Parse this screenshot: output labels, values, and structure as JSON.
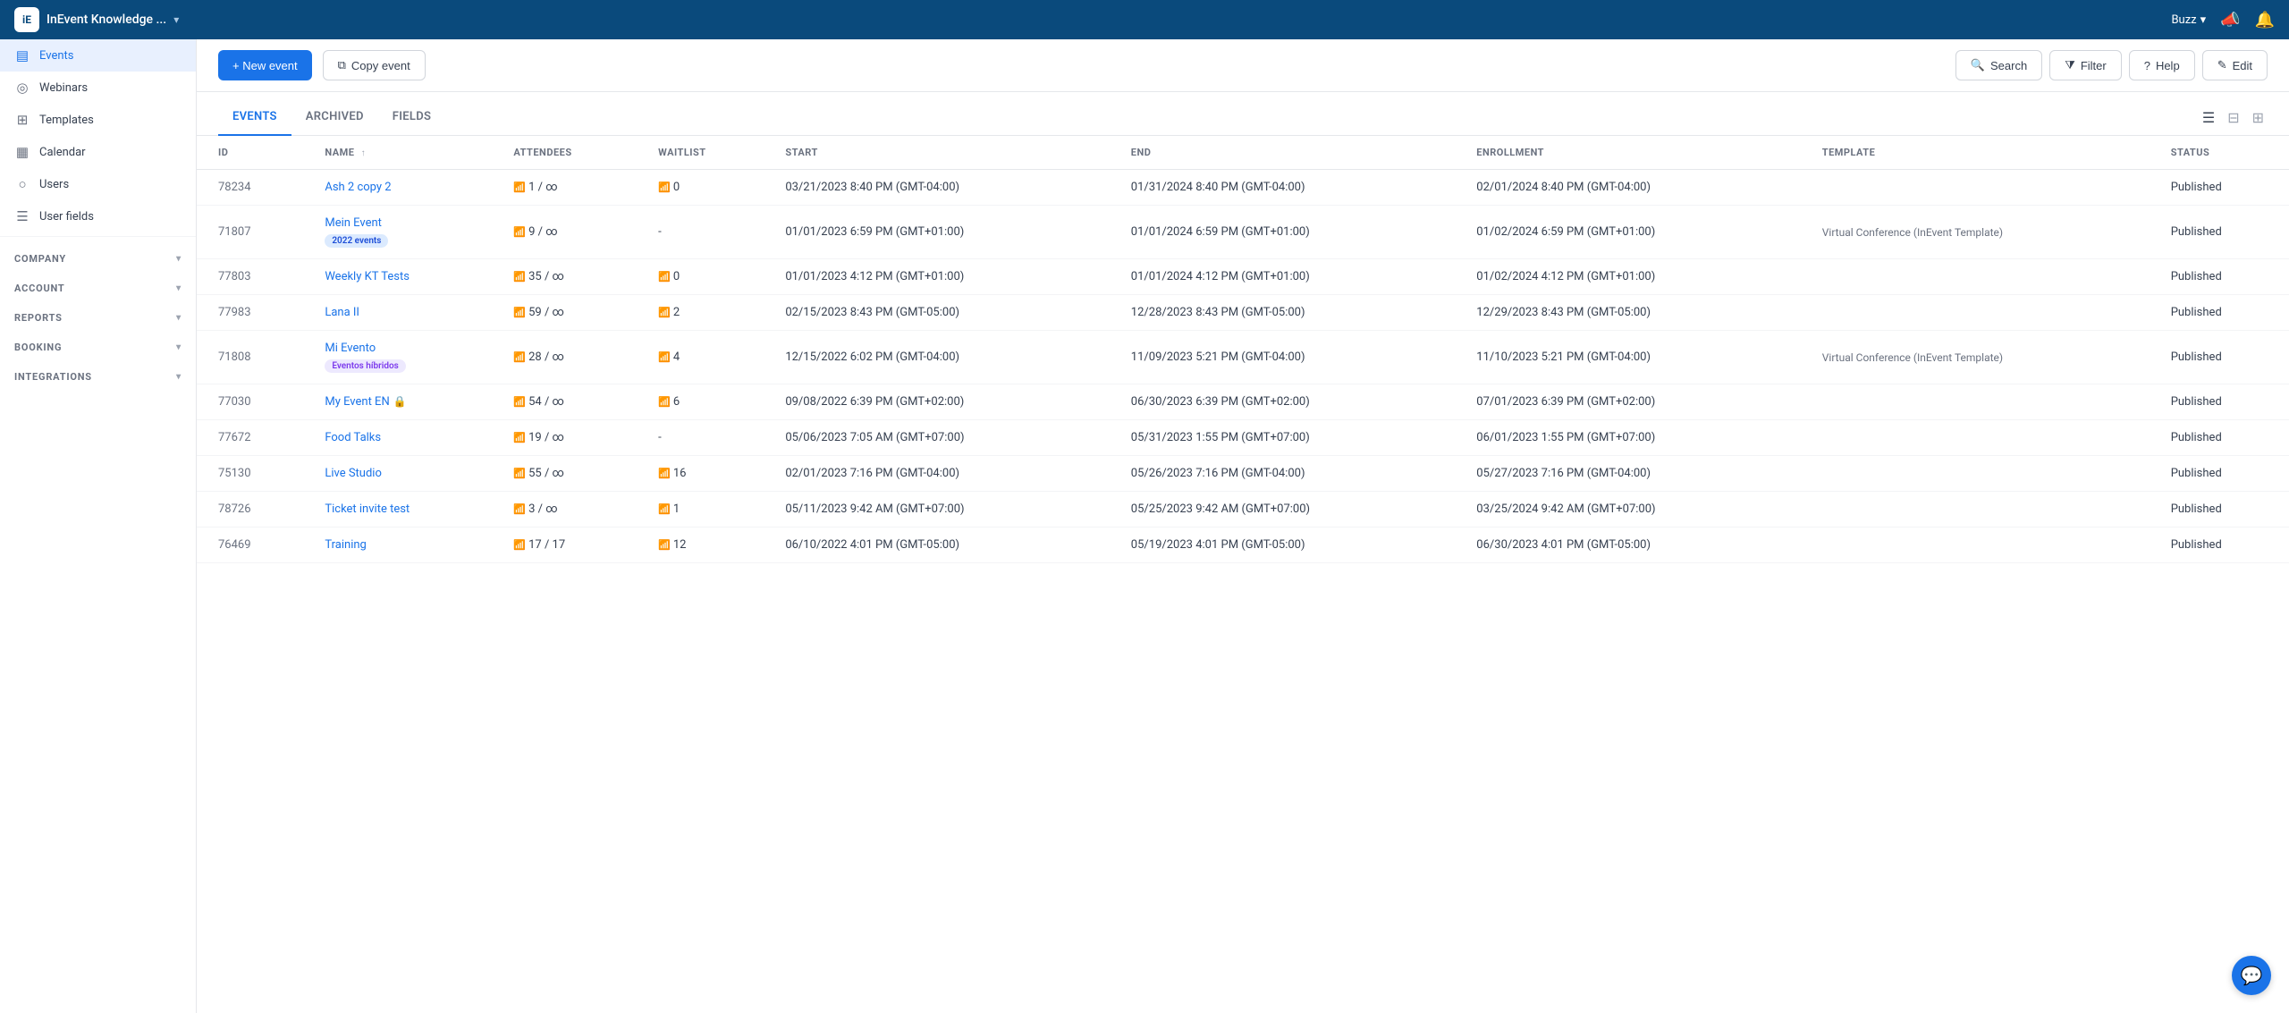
{
  "app": {
    "title": "InEvent Knowledge ...",
    "chevron": "▾"
  },
  "topnav": {
    "buzz_label": "Buzz",
    "chevron": "▾"
  },
  "sidebar": {
    "events_label": "EVENTS",
    "items": [
      {
        "id": "events",
        "label": "Events",
        "icon": "▤",
        "active": true
      },
      {
        "id": "webinars",
        "label": "Webinars",
        "icon": "🎙",
        "active": false
      },
      {
        "id": "templates",
        "label": "Templates",
        "icon": "◎",
        "active": false
      },
      {
        "id": "calendar",
        "label": "Calendar",
        "icon": "📅",
        "active": false
      },
      {
        "id": "users",
        "label": "Users",
        "icon": "👤",
        "active": false
      },
      {
        "id": "user-fields",
        "label": "User fields",
        "icon": "☰",
        "active": false
      }
    ],
    "sections": [
      {
        "id": "company",
        "label": "COMPANY",
        "chevron": "▾"
      },
      {
        "id": "account",
        "label": "ACCOUNT",
        "chevron": "▾"
      },
      {
        "id": "reports",
        "label": "REPORTS",
        "chevron": "▾"
      },
      {
        "id": "booking",
        "label": "BOOKING",
        "chevron": "▾"
      },
      {
        "id": "integrations",
        "label": "INTEGRATIONS",
        "chevron": "▾"
      }
    ]
  },
  "toolbar": {
    "new_event_label": "+ New event",
    "copy_event_label": "Copy event",
    "search_label": "Search",
    "filter_label": "Filter",
    "help_label": "Help",
    "edit_label": "Edit"
  },
  "tabs": {
    "items": [
      {
        "id": "events",
        "label": "EVENTS",
        "active": true
      },
      {
        "id": "archived",
        "label": "ARCHIVED",
        "active": false
      },
      {
        "id": "fields",
        "label": "FIELDS",
        "active": false
      }
    ]
  },
  "table": {
    "columns": [
      {
        "id": "id",
        "label": "ID"
      },
      {
        "id": "name",
        "label": "Name",
        "sort": "↑"
      },
      {
        "id": "attendees",
        "label": "Attendees"
      },
      {
        "id": "waitlist",
        "label": "Waitlist"
      },
      {
        "id": "start",
        "label": "Start"
      },
      {
        "id": "end",
        "label": "End"
      },
      {
        "id": "enrollment",
        "label": "Enrollment"
      },
      {
        "id": "template",
        "label": "Template"
      },
      {
        "id": "status",
        "label": "Status"
      }
    ],
    "rows": [
      {
        "id": "78234",
        "name": "Ash 2 copy 2",
        "name_link": true,
        "tags": [],
        "attendees": "1 / ∞",
        "waitlist": "0",
        "start": "03/21/2023 8:40 PM (GMT-04:00)",
        "end": "01/31/2024 8:40 PM (GMT-04:00)",
        "enrollment": "02/01/2024 8:40 PM (GMT-04:00)",
        "template": "",
        "status": "Published",
        "lock": false
      },
      {
        "id": "71807",
        "name": "Mein Event",
        "name_link": true,
        "tags": [
          "2022 events"
        ],
        "tag_color": "blue",
        "attendees": "9 / ∞",
        "waitlist": "-",
        "start": "01/01/2023 6:59 PM (GMT+01:00)",
        "end": "01/01/2024 6:59 PM (GMT+01:00)",
        "enrollment": "01/02/2024 6:59 PM (GMT+01:00)",
        "template": "Virtual Conference (InEvent Template)",
        "status": "Published",
        "lock": false
      },
      {
        "id": "77803",
        "name": "Weekly KT Tests",
        "name_link": true,
        "tags": [],
        "attendees": "35 / ∞",
        "waitlist": "0",
        "start": "01/01/2023 4:12 PM (GMT+01:00)",
        "end": "01/01/2024 4:12 PM (GMT+01:00)",
        "enrollment": "01/02/2024 4:12 PM (GMT+01:00)",
        "template": "",
        "status": "Published",
        "lock": false
      },
      {
        "id": "77983",
        "name": "Lana II",
        "name_link": true,
        "tags": [],
        "attendees": "59 / ∞",
        "waitlist": "2",
        "start": "02/15/2023 8:43 PM (GMT-05:00)",
        "end": "12/28/2023 8:43 PM (GMT-05:00)",
        "enrollment": "12/29/2023 8:43 PM (GMT-05:00)",
        "template": "",
        "status": "Published",
        "lock": false
      },
      {
        "id": "71808",
        "name": "Mi Evento",
        "name_link": true,
        "tags": [
          "Eventos híbridos"
        ],
        "tag_color": "purple",
        "attendees": "28 / ∞",
        "waitlist": "4",
        "start": "12/15/2022 6:02 PM (GMT-04:00)",
        "end": "11/09/2023 5:21 PM (GMT-04:00)",
        "enrollment": "11/10/2023 5:21 PM (GMT-04:00)",
        "template": "Virtual Conference (InEvent Template)",
        "status": "Published",
        "lock": false
      },
      {
        "id": "77030",
        "name": "My Event EN",
        "name_link": true,
        "tags": [],
        "attendees": "54 / ∞",
        "waitlist": "6",
        "start": "09/08/2022 6:39 PM (GMT+02:00)",
        "end": "06/30/2023 6:39 PM (GMT+02:00)",
        "enrollment": "07/01/2023 6:39 PM (GMT+02:00)",
        "template": "",
        "status": "Published",
        "lock": true
      },
      {
        "id": "77672",
        "name": "Food Talks",
        "name_link": true,
        "tags": [],
        "attendees": "19 / ∞",
        "waitlist": "-",
        "start": "05/06/2023 7:05 AM (GMT+07:00)",
        "end": "05/31/2023 1:55 PM (GMT+07:00)",
        "enrollment": "06/01/2023 1:55 PM (GMT+07:00)",
        "template": "",
        "status": "Published",
        "lock": false
      },
      {
        "id": "75130",
        "name": "Live Studio",
        "name_link": true,
        "tags": [],
        "attendees": "55 / ∞",
        "waitlist": "16",
        "start": "02/01/2023 7:16 PM (GMT-04:00)",
        "end": "05/26/2023 7:16 PM (GMT-04:00)",
        "enrollment": "05/27/2023 7:16 PM (GMT-04:00)",
        "template": "",
        "status": "Published",
        "lock": false
      },
      {
        "id": "78726",
        "name": "Ticket invite test",
        "name_link": true,
        "tags": [],
        "attendees": "3 / ∞",
        "waitlist": "1",
        "start": "05/11/2023 9:42 AM (GMT+07:00)",
        "end": "05/25/2023 9:42 AM (GMT+07:00)",
        "enrollment": "03/25/2024 9:42 AM (GMT+07:00)",
        "template": "",
        "status": "Published",
        "lock": false
      },
      {
        "id": "76469",
        "name": "Training",
        "name_link": true,
        "tags": [],
        "attendees": "17 / 17",
        "waitlist": "12",
        "start": "06/10/2022 4:01 PM (GMT-05:00)",
        "end": "05/19/2023 4:01 PM (GMT-05:00)",
        "enrollment": "06/30/2023 4:01 PM (GMT-05:00)",
        "template": "",
        "status": "Published",
        "lock": false
      }
    ]
  },
  "colors": {
    "primary": "#1a73e8",
    "nav_bg": "#0a4a7c",
    "sidebar_bg": "#ffffff",
    "active_item": "#e8f0fe"
  }
}
